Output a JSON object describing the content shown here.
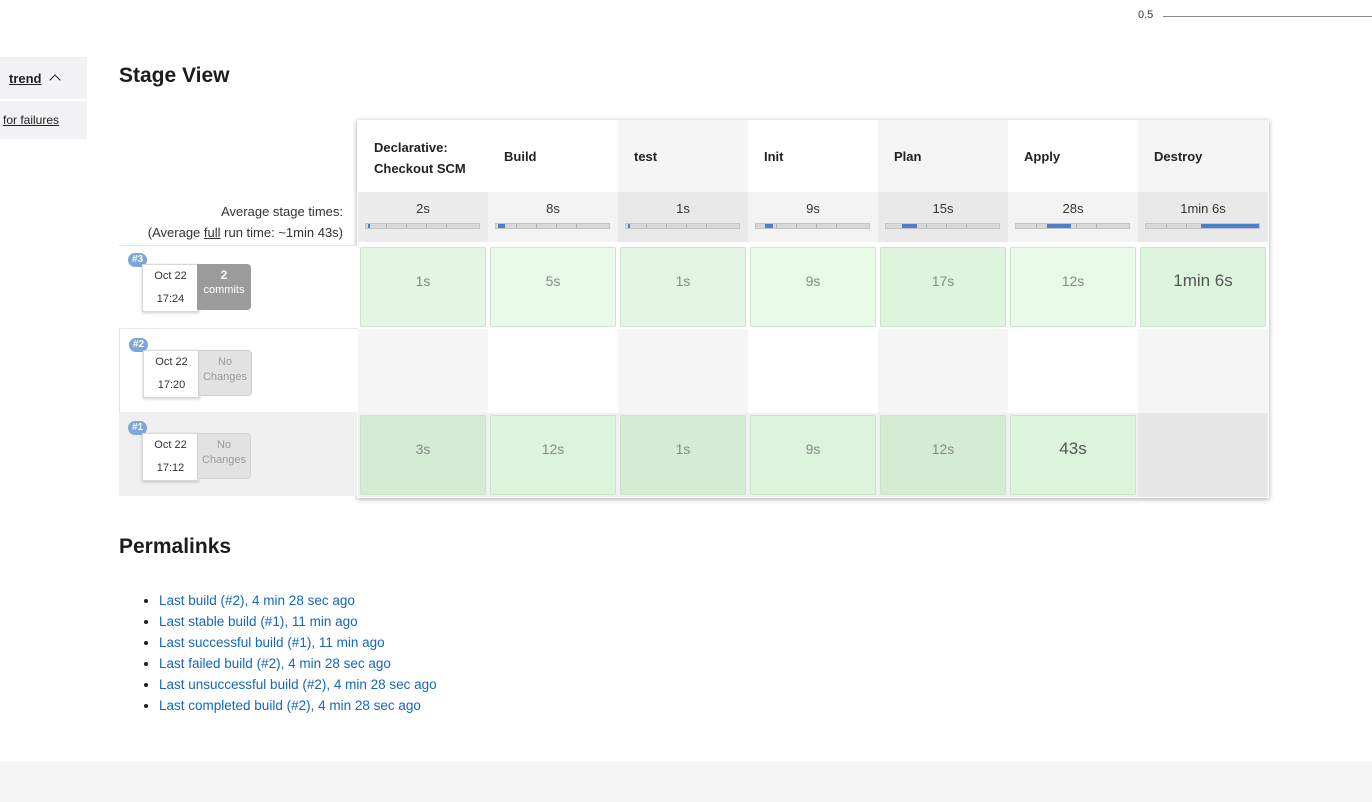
{
  "header": {
    "scale_label": "0.5"
  },
  "sidebar": {
    "trend_label": "trend",
    "failures_label": "for failures"
  },
  "stage_view": {
    "title": "Stage View",
    "avg_label_line1": "Average stage times:",
    "avg_label_line2_prefix": "(Average ",
    "avg_label_line2_full": "full",
    "avg_label_line2_suffix": " run time: ~1min 43s)",
    "stages": [
      {
        "name": "Declarative: Checkout SCM",
        "avg": "2s"
      },
      {
        "name": "Build",
        "avg": "8s"
      },
      {
        "name": "test",
        "avg": "1s"
      },
      {
        "name": "Init",
        "avg": "9s"
      },
      {
        "name": "Plan",
        "avg": "15s"
      },
      {
        "name": "Apply",
        "avg": "28s"
      },
      {
        "name": "Destroy",
        "avg": "1min 6s"
      }
    ],
    "builds": [
      {
        "id": "#3",
        "date": "Oct 22",
        "time": "17:24",
        "changes_count": "2",
        "changes_label": "commits",
        "cells": [
          "1s",
          "5s",
          "1s",
          "9s",
          "17s",
          "12s",
          "1min 6s"
        ]
      },
      {
        "id": "#2",
        "date": "Oct 22",
        "time": "17:20",
        "changes_line1": "No",
        "changes_line2": "Changes",
        "cells": [
          "",
          "",
          "",
          "",
          "",
          "",
          ""
        ]
      },
      {
        "id": "#1",
        "date": "Oct 22",
        "time": "17:12",
        "changes_line1": "No",
        "changes_line2": "Changes",
        "cells": [
          "3s",
          "12s",
          "1s",
          "9s",
          "12s",
          "43s",
          ""
        ]
      }
    ]
  },
  "permalinks": {
    "title": "Permalinks",
    "items": [
      "Last build (#2), 4 min 28 sec ago",
      "Last stable build (#1), 11 min ago",
      "Last successful build (#1), 11 min ago",
      "Last failed build (#2), 4 min 28 sec ago",
      "Last unsuccessful build (#2), 4 min 28 sec ago",
      "Last completed build (#2), 4 min 28 sec ago"
    ]
  },
  "colors": {
    "success_cell": "#e3f7e3",
    "success_cell_alt": "#d3ecd3",
    "accent_bar": "#4b7fc9",
    "link": "#1565c0",
    "badge": "#7da6da"
  }
}
